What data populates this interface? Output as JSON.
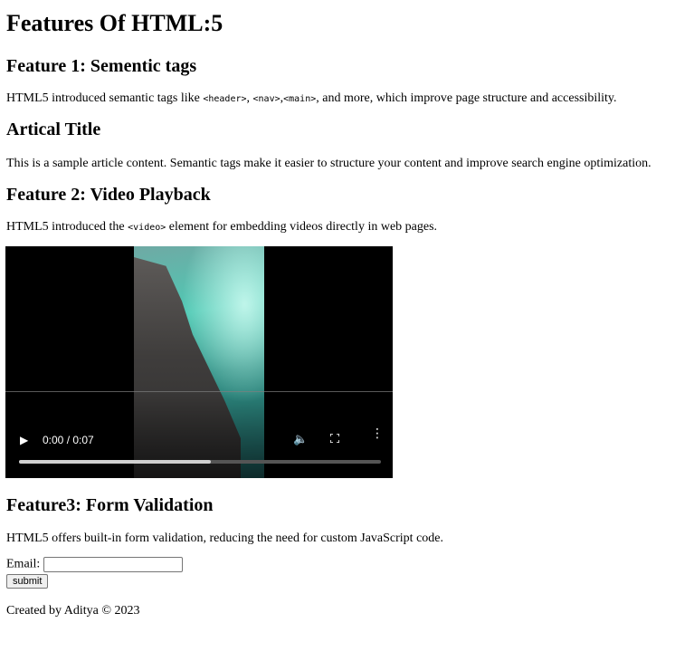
{
  "title": "Features Of HTML:5",
  "feature1": {
    "heading": "Feature 1: Sementic tags",
    "text_before": "HTML5 introduced semantic tags like ",
    "code1": "<header>",
    "sep1": ", ",
    "code2": "<nav>",
    "sep2": ",",
    "code3": "<main>",
    "text_after": ", and more, which improve page structure and accessibility."
  },
  "article": {
    "heading": "Artical Title",
    "text": "This is a sample article content. Semantic tags make it easier to structure your content and improve search engine optimization."
  },
  "feature2": {
    "heading": "Feature 2: Video Playback",
    "text_before": "HTML5 introduced the ",
    "code": "<video>",
    "text_after": " element for embedding videos directly in web pages."
  },
  "video": {
    "time": "0:00 / 0:07",
    "progress_fraction": 0.53
  },
  "feature3": {
    "heading": "Feature3: Form Validation",
    "text": "HTML5 offers built-in form validation, reducing the need for custom JavaScript code."
  },
  "form": {
    "email_label": "Email:",
    "email_value": "",
    "submit_label": "submit"
  },
  "footer": {
    "text": "Created by Aditya © 2023"
  }
}
